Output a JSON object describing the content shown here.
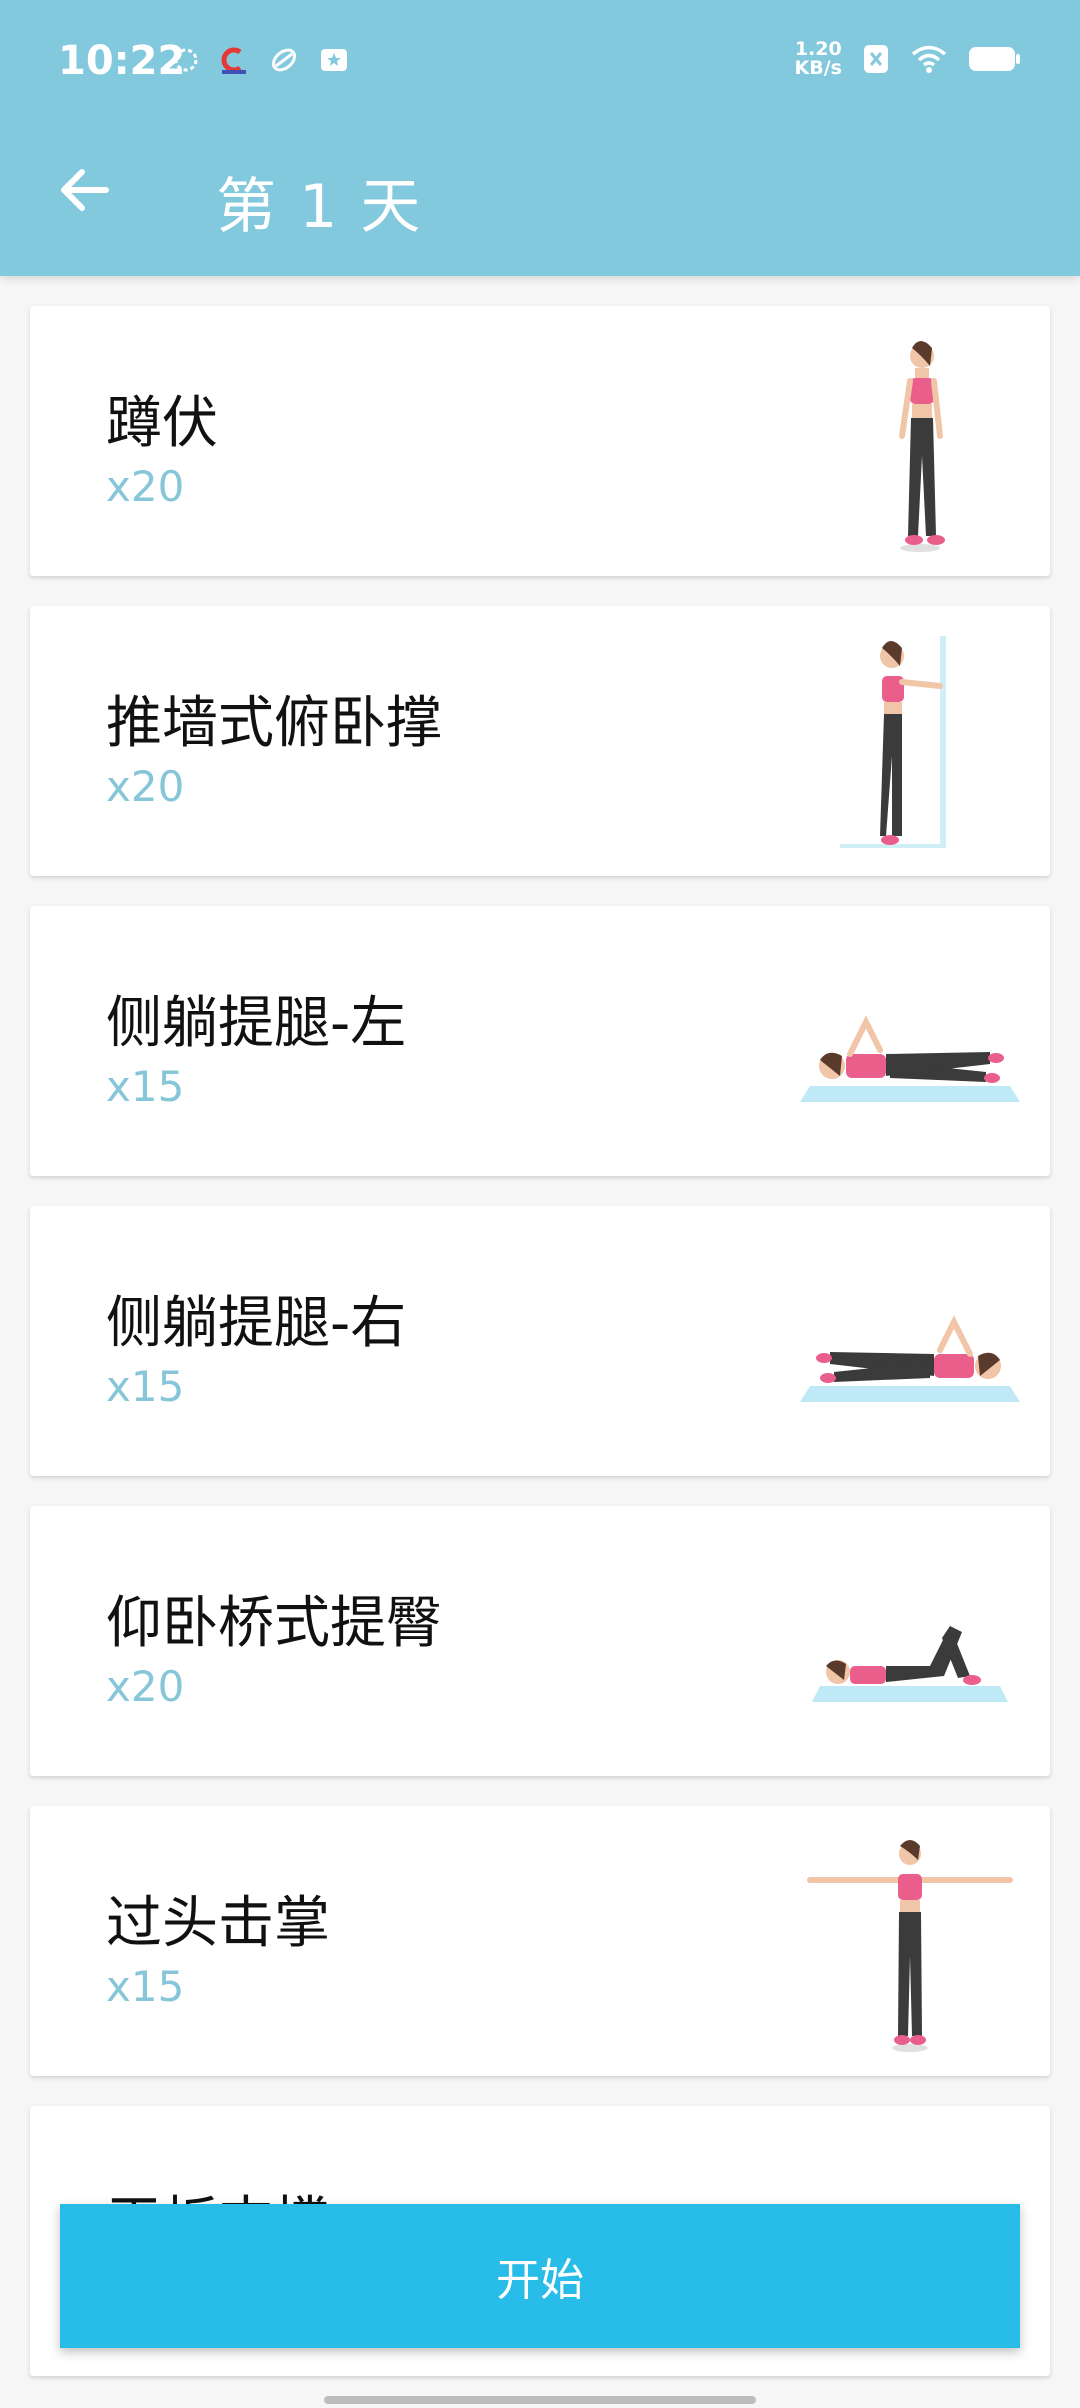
{
  "status_bar": {
    "time": "10:22",
    "net_speed_value": "1.20",
    "net_speed_unit": "KB/s"
  },
  "header": {
    "title": "第 1 天"
  },
  "exercises": [
    {
      "name": "蹲伏",
      "count": "x20",
      "figure": "standing"
    },
    {
      "name": "推墙式俯卧撑",
      "count": "x20",
      "figure": "wall-pushup"
    },
    {
      "name": "侧躺提腿-左",
      "count": "x15",
      "figure": "side-lying-left"
    },
    {
      "name": "侧躺提腿-右",
      "count": "x15",
      "figure": "side-lying-right"
    },
    {
      "name": "仰卧桥式提臀",
      "count": "x20",
      "figure": "glute-bridge"
    },
    {
      "name": "过头击掌",
      "count": "x15",
      "figure": "arms-out"
    },
    {
      "name": "平板支撑",
      "count": "",
      "figure": "plank"
    }
  ],
  "footer": {
    "start_label": "开始"
  },
  "colors": {
    "header_bg": "#83c9dd",
    "count_text": "#86c6d8",
    "start_button": "#27bde8"
  }
}
